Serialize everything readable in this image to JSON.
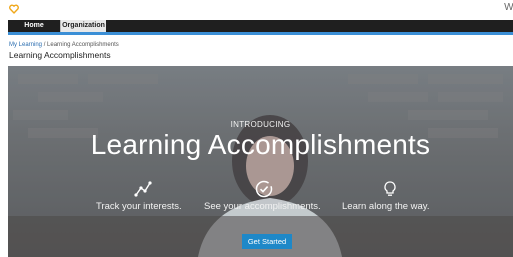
{
  "header": {
    "welcome_text": "We"
  },
  "nav": {
    "tabs": [
      {
        "label": "Home"
      },
      {
        "label": "Organization"
      }
    ]
  },
  "breadcrumb": {
    "root": "My Learning",
    "separator": " / ",
    "current": "Learning Accomplishments"
  },
  "page": {
    "title": "Learning Accomplishments"
  },
  "hero": {
    "intro": "INTRODUCING",
    "headline": "Learning Accomplishments",
    "features": [
      {
        "icon": "trend-line-icon",
        "label": "Track your interests."
      },
      {
        "icon": "check-circle-icon",
        "label": "See your accomplishments."
      },
      {
        "icon": "lightbulb-icon",
        "label": "Learn along the way."
      }
    ],
    "cta_label": "Get Started"
  },
  "colors": {
    "nav_background": "#1f1f1f",
    "nav_accent_line": "#3b8fd6",
    "link": "#2a6db0",
    "cta_background": "#1e88c8",
    "logo": "#f0a81c"
  }
}
